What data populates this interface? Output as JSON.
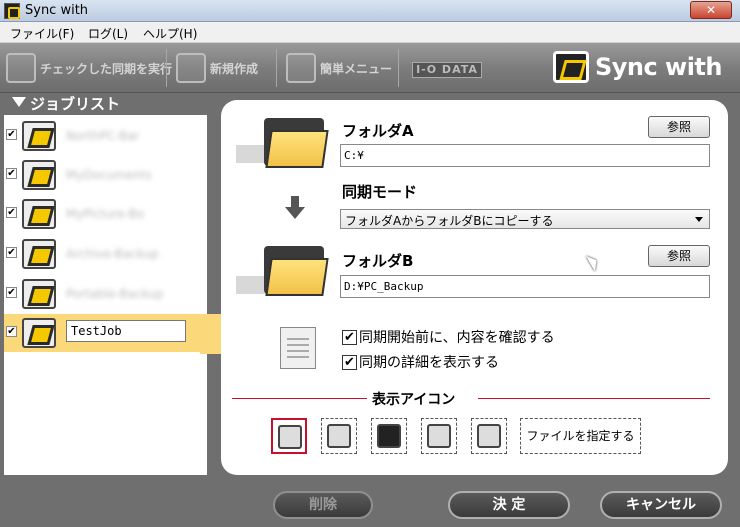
{
  "window": {
    "title": "Sync with",
    "close_label": "✕"
  },
  "menu": [
    "ファイル(F)",
    "ログ(L)",
    "ヘルプ(H)"
  ],
  "toolbar": {
    "run_checked": "チェックした同期を実行",
    "new_create": "新規作成",
    "easy_menu": "簡単メニュー",
    "iodata": "I-O DATA",
    "brand": "Sync with"
  },
  "joblist": {
    "header": "ジョブリスト",
    "items": [
      {
        "name": "NorthPC-Bar",
        "checked": "✔"
      },
      {
        "name": "MyDocuments",
        "checked": "✔"
      },
      {
        "name": "MyPicture-Bo",
        "checked": "✔"
      },
      {
        "name": "Archive-Backup",
        "checked": "✔"
      },
      {
        "name": "Portable-Backup",
        "checked": "✔"
      },
      {
        "name": "TestJob",
        "checked": "✔"
      }
    ]
  },
  "folder_a": {
    "label": "フォルダA",
    "browse": "参照",
    "path": "C:¥"
  },
  "sync_mode": {
    "label": "同期モード",
    "selected": "フォルダAからフォルダBにコピーする"
  },
  "folder_b": {
    "label": "フォルダB",
    "browse": "参照",
    "path": "D:¥PC_Backup"
  },
  "options": [
    {
      "label": "同期開始前に、内容を確認する",
      "checked": "✔"
    },
    {
      "label": "同期の詳細を表示する",
      "checked": "✔"
    }
  ],
  "display_icon": {
    "title": "表示アイコン",
    "file_button": "ファイルを指定する"
  },
  "buttons": {
    "delete": "削除",
    "ok": "決 定",
    "cancel": "キャンセル"
  },
  "colors": {
    "accent": "#c8102e",
    "selected_job": "#fbd97a",
    "folder": "#f1c24a"
  }
}
